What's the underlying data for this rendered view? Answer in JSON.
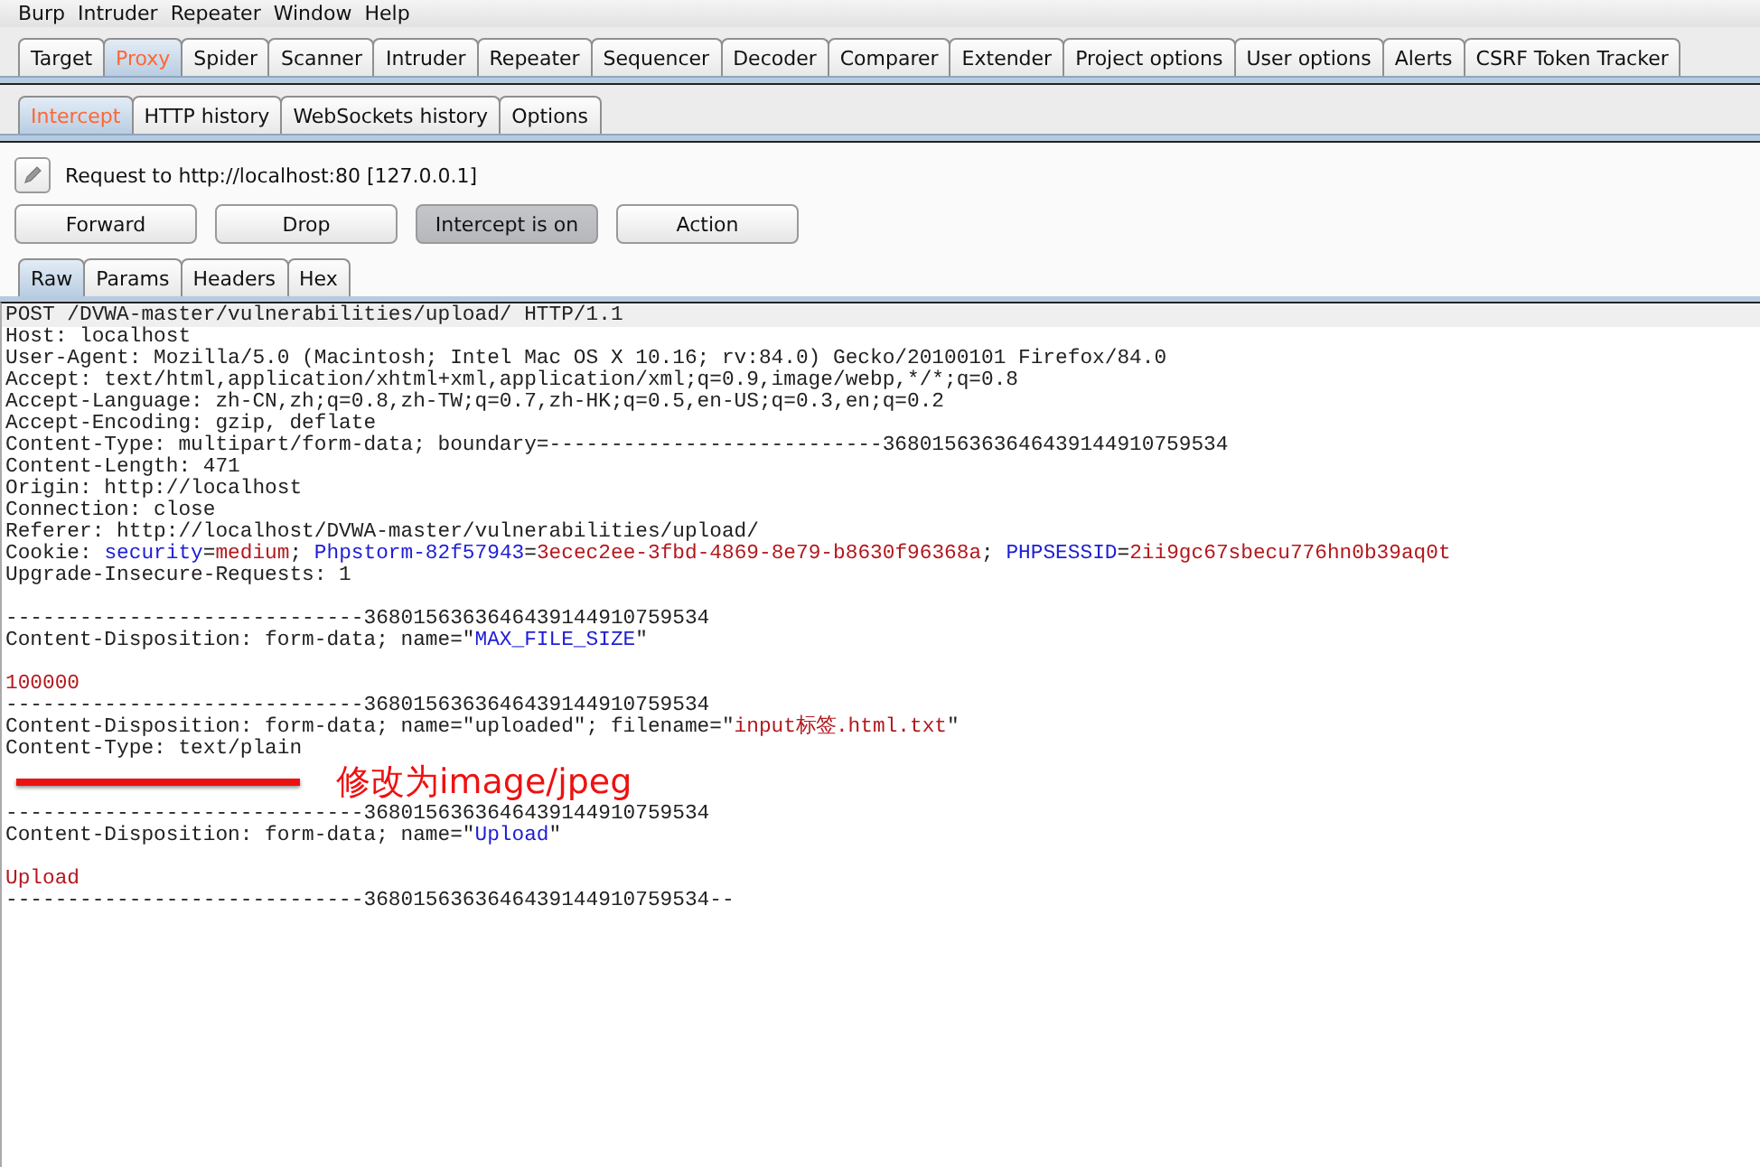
{
  "menu_bar": [
    "Burp",
    "Intruder",
    "Repeater",
    "Window",
    "Help"
  ],
  "main_tabs": [
    {
      "label": "Target",
      "selected": false
    },
    {
      "label": "Proxy",
      "selected": true
    },
    {
      "label": "Spider",
      "selected": false
    },
    {
      "label": "Scanner",
      "selected": false
    },
    {
      "label": "Intruder",
      "selected": false
    },
    {
      "label": "Repeater",
      "selected": false
    },
    {
      "label": "Sequencer",
      "selected": false
    },
    {
      "label": "Decoder",
      "selected": false
    },
    {
      "label": "Comparer",
      "selected": false
    },
    {
      "label": "Extender",
      "selected": false
    },
    {
      "label": "Project options",
      "selected": false
    },
    {
      "label": "User options",
      "selected": false
    },
    {
      "label": "Alerts",
      "selected": false
    },
    {
      "label": "CSRF Token Tracker",
      "selected": false
    }
  ],
  "proxy_tabs": [
    {
      "label": "Intercept",
      "selected": true
    },
    {
      "label": "HTTP history",
      "selected": false
    },
    {
      "label": "WebSockets history",
      "selected": false
    },
    {
      "label": "Options",
      "selected": false
    }
  ],
  "request_info": "Request to http://localhost:80  [127.0.0.1]",
  "buttons": [
    {
      "label": "Forward",
      "pressed": false
    },
    {
      "label": "Drop",
      "pressed": false
    },
    {
      "label": "Intercept is on",
      "pressed": true
    },
    {
      "label": "Action",
      "pressed": false
    }
  ],
  "view_tabs": [
    {
      "label": "Raw",
      "selected": true
    },
    {
      "label": "Params",
      "selected": false
    },
    {
      "label": "Headers",
      "selected": false
    },
    {
      "label": "Hex",
      "selected": false
    }
  ],
  "request_lines": [
    {
      "kind": "text",
      "segments": [
        {
          "kind": "plain",
          "text": "POST /DVWA-master/vulnerabilities/upload/ HTTP/1.1"
        }
      ]
    },
    {
      "kind": "text",
      "segments": [
        {
          "kind": "plain",
          "text": "Host: localhost"
        }
      ]
    },
    {
      "kind": "text",
      "segments": [
        {
          "kind": "plain",
          "text": "User-Agent: Mozilla/5.0 (Macintosh; Intel Mac OS X 10.16; rv:84.0) Gecko/20100101 Firefox/84.0"
        }
      ]
    },
    {
      "kind": "text",
      "segments": [
        {
          "kind": "plain",
          "text": "Accept: text/html,application/xhtml+xml,application/xml;q=0.9,image/webp,*/*;q=0.8"
        }
      ]
    },
    {
      "kind": "text",
      "segments": [
        {
          "kind": "plain",
          "text": "Accept-Language: zh-CN,zh;q=0.8,zh-TW;q=0.7,zh-HK;q=0.5,en-US;q=0.3,en;q=0.2"
        }
      ]
    },
    {
      "kind": "text",
      "segments": [
        {
          "kind": "plain",
          "text": "Accept-Encoding: gzip, deflate"
        }
      ]
    },
    {
      "kind": "text",
      "segments": [
        {
          "kind": "plain",
          "text": "Content-Type: multipart/form-data; boundary=---------------------------3680156363646439144910759534"
        }
      ]
    },
    {
      "kind": "text",
      "segments": [
        {
          "kind": "plain",
          "text": "Content-Length: 471"
        }
      ]
    },
    {
      "kind": "text",
      "segments": [
        {
          "kind": "plain",
          "text": "Origin: http://localhost"
        }
      ]
    },
    {
      "kind": "text",
      "segments": [
        {
          "kind": "plain",
          "text": "Connection: close"
        }
      ]
    },
    {
      "kind": "text",
      "segments": [
        {
          "kind": "plain",
          "text": "Referer: http://localhost/DVWA-master/vulnerabilities/upload/"
        }
      ]
    },
    {
      "kind": "text",
      "segments": [
        {
          "kind": "plain",
          "text": "Cookie: "
        },
        {
          "kind": "name",
          "text": "security"
        },
        {
          "kind": "plain",
          "text": "="
        },
        {
          "kind": "value",
          "text": "medium"
        },
        {
          "kind": "plain",
          "text": "; "
        },
        {
          "kind": "name",
          "text": "Phpstorm-82f57943"
        },
        {
          "kind": "plain",
          "text": "="
        },
        {
          "kind": "value",
          "text": "3ecec2ee-3fbd-4869-8e79-b8630f96368a"
        },
        {
          "kind": "plain",
          "text": "; "
        },
        {
          "kind": "name",
          "text": "PHPSESSID"
        },
        {
          "kind": "plain",
          "text": "="
        },
        {
          "kind": "value",
          "text": "2ii9gc67sbecu776hn0b39aq0t"
        }
      ]
    },
    {
      "kind": "text",
      "segments": [
        {
          "kind": "plain",
          "text": "Upgrade-Insecure-Requests: 1"
        }
      ]
    },
    {
      "kind": "blank"
    },
    {
      "kind": "text",
      "segments": [
        {
          "kind": "plain",
          "text": "-----------------------------3680156363646439144910759534"
        }
      ]
    },
    {
      "kind": "text",
      "segments": [
        {
          "kind": "plain",
          "text": "Content-Disposition: form-data; name=\""
        },
        {
          "kind": "name",
          "text": "MAX_FILE_SIZE"
        },
        {
          "kind": "plain",
          "text": "\""
        }
      ]
    },
    {
      "kind": "blank"
    },
    {
      "kind": "text",
      "segments": [
        {
          "kind": "value",
          "text": "100000"
        }
      ]
    },
    {
      "kind": "text",
      "segments": [
        {
          "kind": "plain",
          "text": "-----------------------------3680156363646439144910759534"
        }
      ]
    },
    {
      "kind": "text",
      "segments": [
        {
          "kind": "plain",
          "text": "Content-Disposition: form-data; name=\"uploaded\"; filename=\""
        },
        {
          "kind": "value",
          "text": "input标签.html.txt"
        },
        {
          "kind": "plain",
          "text": "\""
        }
      ]
    },
    {
      "kind": "text",
      "segments": [
        {
          "kind": "plain",
          "text": "Content-Type: text/plain"
        }
      ]
    },
    {
      "kind": "annotation",
      "text": "修改为image/jpeg"
    },
    {
      "kind": "text",
      "segments": [
        {
          "kind": "plain",
          "text": "-----------------------------3680156363646439144910759534"
        }
      ]
    },
    {
      "kind": "text",
      "segments": [
        {
          "kind": "plain",
          "text": "Content-Disposition: form-data; name=\""
        },
        {
          "kind": "name",
          "text": "Upload"
        },
        {
          "kind": "plain",
          "text": "\""
        }
      ]
    },
    {
      "kind": "blank"
    },
    {
      "kind": "text",
      "segments": [
        {
          "kind": "value",
          "text": "Upload"
        }
      ]
    },
    {
      "kind": "text",
      "segments": [
        {
          "kind": "plain",
          "text": "-----------------------------3680156363646439144910759534--"
        }
      ]
    }
  ]
}
